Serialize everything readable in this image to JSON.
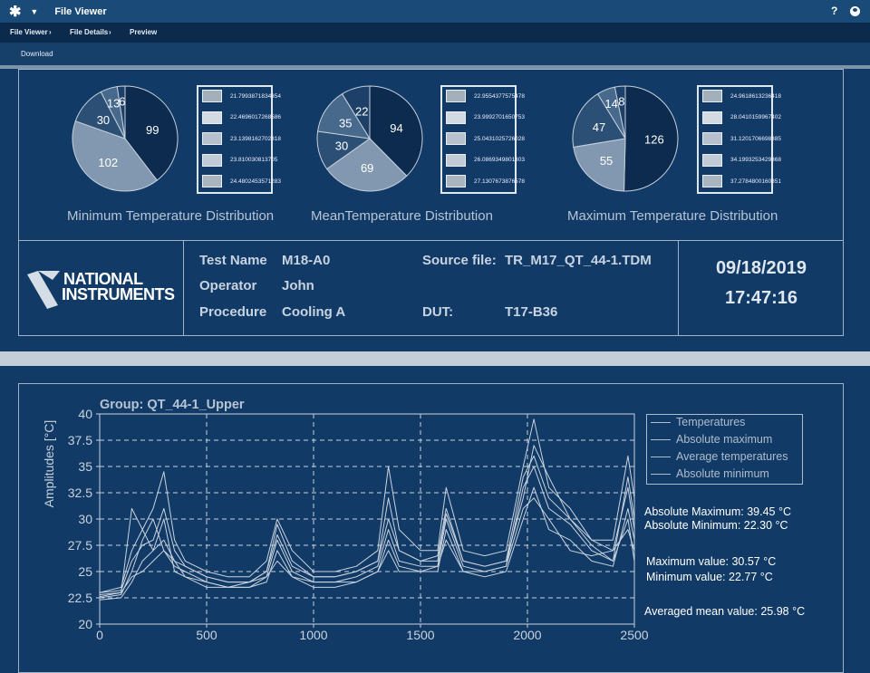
{
  "app": {
    "title": "File Viewer",
    "help": "?",
    "logo_glyph": "✱"
  },
  "breadcrumb": [
    "File Viewer",
    "File Details",
    "Preview"
  ],
  "toolbar": {
    "download": "Download"
  },
  "pies": [
    {
      "title": "Minimum Temperature Distribution",
      "values": [
        99,
        102,
        30,
        13,
        6
      ],
      "legend": [
        "21.7993871834354",
        "22.4696017268586",
        "23.1398162702818",
        "23.810030813705",
        "24.4802453571283"
      ]
    },
    {
      "title": "MeanTemperature Distribution",
      "values": [
        94,
        69,
        30,
        35,
        22
      ],
      "legend": [
        "22.9554377575478",
        "23.9992701650753",
        "25.0431025726028",
        "26.0869349801303",
        "27.1307673876578"
      ]
    },
    {
      "title": "Maximum Temperature Distribution",
      "values": [
        126,
        55,
        47,
        14,
        8
      ],
      "legend": [
        "24.9618613236418",
        "28.0410159967402",
        "31.1201706698385",
        "34.1993253429368",
        "37.2784800160351"
      ]
    }
  ],
  "pie_colors": [
    "#0d2a4f",
    "#8298b0",
    "#2c5075",
    "#46698c",
    "#1d4068"
  ],
  "legend_swatches": [
    "#a3afbb",
    "#d3dae2",
    "#b7c1cd",
    "#c3ccd6",
    "#aab5c1"
  ],
  "info": {
    "logo_text": [
      "NATIONAL",
      "INSTRUMENTS"
    ],
    "test_name_label": "Test Name",
    "test_name": "M18-A0",
    "operator_label": "Operator",
    "operator": "John",
    "procedure_label": "Procedure",
    "procedure": "Cooling A",
    "source_label": "Source file:",
    "source": "TR_M17_QT_44-1.TDM",
    "dut_label": "DUT:",
    "dut": "T17-B36",
    "date": "09/18/2019",
    "time": "17:47:16"
  },
  "chart_data": {
    "type": "line",
    "title": "Group: QT_44-1_Upper",
    "ylabel": "Amplitudes [°C]",
    "xlabel": "",
    "xlim": [
      0,
      2500
    ],
    "ylim": [
      20,
      40
    ],
    "xticks": [
      "0",
      "500",
      "1000",
      "1500",
      "2000",
      "2500"
    ],
    "yticks": [
      "20",
      "22.5",
      "25",
      "27.5",
      "30",
      "32.5",
      "35",
      "37.5",
      "40"
    ],
    "grid": true,
    "legend": [
      "Temperatures",
      "Absolute maximum",
      "Average temperatures",
      "Absolute minimum"
    ],
    "legend_position": "top-right",
    "x": [
      0,
      100,
      150,
      200,
      250,
      300,
      350,
      400,
      500,
      600,
      700,
      780,
      830,
      900,
      1000,
      1100,
      1200,
      1300,
      1350,
      1400,
      1500,
      1580,
      1620,
      1700,
      1800,
      1900,
      1980,
      2030,
      2100,
      2200,
      2300,
      2400,
      2470,
      2500
    ],
    "series": [
      {
        "values": [
          23,
          23.5,
          27,
          29,
          31,
          34.5,
          28,
          26,
          25,
          24.5,
          24.5,
          26,
          30,
          27,
          25,
          25,
          25.5,
          27,
          35,
          29,
          27,
          27,
          33,
          27,
          26.5,
          27,
          35,
          39.5,
          33,
          31,
          28,
          28,
          36,
          32
        ]
      },
      {
        "values": [
          22.8,
          23,
          31,
          29,
          27,
          28,
          26,
          25.5,
          24.5,
          24,
          24,
          25,
          29.5,
          26,
          24.5,
          24.5,
          25,
          26,
          30,
          27,
          26,
          26.5,
          31,
          26,
          25.5,
          26,
          32,
          37,
          34,
          30,
          28,
          27,
          33,
          29
        ]
      },
      {
        "values": [
          22.5,
          22.8,
          25,
          28,
          30,
          27,
          25.5,
          25,
          24,
          23.5,
          23.5,
          24.5,
          28,
          25,
          24,
          24,
          24.5,
          25.5,
          29,
          26,
          25.5,
          25.5,
          30,
          25.5,
          25,
          25.5,
          33,
          35,
          31,
          29.5,
          27,
          26,
          34,
          30
        ]
      },
      {
        "values": [
          22.3,
          22.5,
          24,
          26,
          27,
          30,
          25,
          24.5,
          23.5,
          23.5,
          23.5,
          24,
          27,
          24.5,
          23.5,
          23.5,
          24,
          25,
          28,
          25.5,
          25,
          25,
          29,
          25,
          24.5,
          25,
          30,
          33,
          29,
          28,
          26,
          25.5,
          31,
          28
        ]
      },
      {
        "values": [
          22.6,
          23,
          24.5,
          25,
          26,
          27,
          26,
          24.5,
          24,
          23.5,
          24,
          24.5,
          26,
          24.5,
          24,
          24,
          24,
          25,
          27,
          25,
          25,
          25.5,
          28,
          25,
          25,
          25.5,
          31,
          32,
          30,
          27,
          26.5,
          27,
          29,
          27
        ]
      },
      {
        "values": [
          23,
          23.2,
          26,
          27.5,
          28,
          31,
          27,
          25.5,
          24.5,
          24,
          24,
          25,
          28.5,
          25.5,
          24.5,
          24.5,
          25,
          26,
          32,
          27,
          26,
          26,
          30.5,
          26,
          25.5,
          26,
          34,
          36,
          32,
          30,
          27.5,
          26,
          30,
          26
        ]
      }
    ],
    "line_color": "#c9d3de"
  },
  "stats": {
    "abs_max": "Absolute Maximum: 39.45 °C",
    "abs_min": "Absolute Minimum: 22.30 °C",
    "max_val": "Maximum value: 30.57 °C",
    "min_val": "Minimum value: 22.77 °C",
    "avg": "Averaged mean value: 25.98 °C"
  }
}
